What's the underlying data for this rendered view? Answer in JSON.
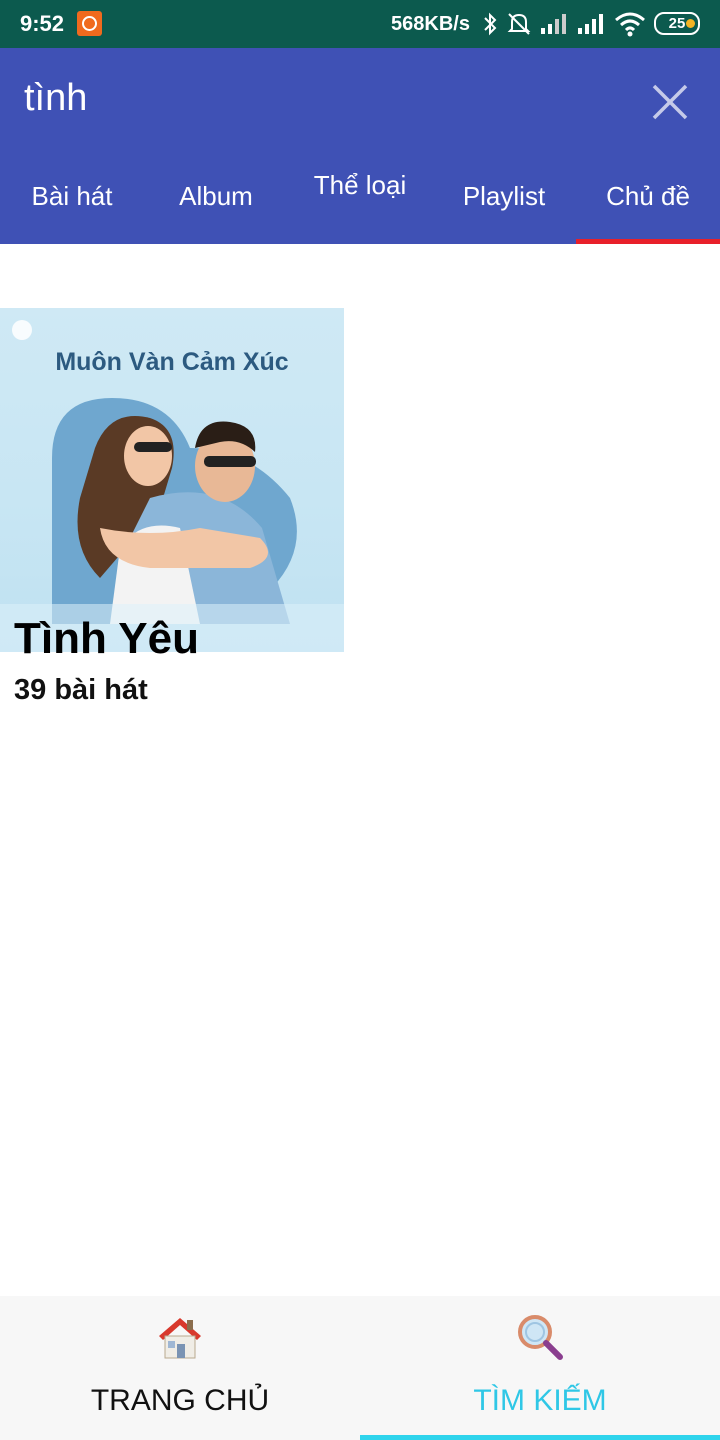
{
  "status_bar": {
    "time": "9:52",
    "speed": "568KB/s",
    "battery": "25"
  },
  "search": {
    "query": "tình",
    "close_icon": "close-icon"
  },
  "tabs": [
    {
      "label": "Bài hát"
    },
    {
      "label": "Album"
    },
    {
      "label": "Thể loại"
    },
    {
      "label": "Playlist"
    },
    {
      "label": "Chủ đề",
      "active": true
    }
  ],
  "results": [
    {
      "cover_text": "Muôn Vàn Cảm Xúc",
      "title": "Tình Yêu",
      "subtitle": "39 bài hát"
    }
  ],
  "bottom_nav": {
    "home_label": "TRANG CHỦ",
    "search_label": "TÌM KIẾM",
    "active": "search"
  },
  "colors": {
    "status_bar": "#0c5a4e",
    "header": "#3f51b5",
    "tab_indicator": "#e8202a",
    "nav_active": "#2fc7e6"
  }
}
